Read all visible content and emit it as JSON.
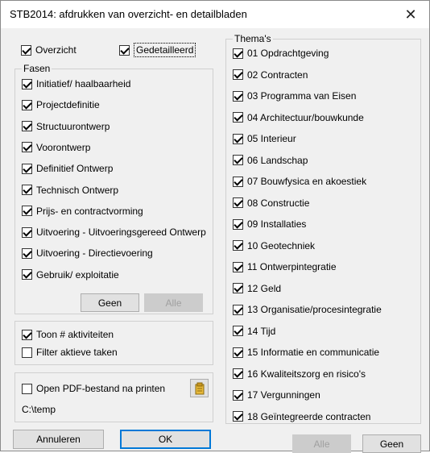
{
  "window": {
    "title": "STB2014: afdrukken van overzicht- en detailbladen",
    "close_glyph": "✕"
  },
  "view": {
    "overzicht": {
      "label": "Overzicht",
      "checked": true
    },
    "gedetailleerd": {
      "label": "Gedetailleerd",
      "checked": true
    }
  },
  "fasen": {
    "legend": "Fasen",
    "items": [
      {
        "label": "Initiatief/ haalbaarheid",
        "checked": true
      },
      {
        "label": "Projectdefinitie",
        "checked": true
      },
      {
        "label": "Structuurontwerp",
        "checked": true
      },
      {
        "label": "Voorontwerp",
        "checked": true
      },
      {
        "label": "Definitief Ontwerp",
        "checked": true
      },
      {
        "label": "Technisch Ontwerp",
        "checked": true
      },
      {
        "label": "Prijs- en contractvorming",
        "checked": true
      },
      {
        "label": "Uitvoering - Uitvoeringsgereed Ontwerp",
        "checked": true
      },
      {
        "label": "Uitvoering - Directievoering",
        "checked": true
      },
      {
        "label": "Gebruik/ exploitatie",
        "checked": true
      }
    ],
    "alle_label": "Alle",
    "geen_label": "Geen"
  },
  "options": {
    "toon": {
      "label": "Toon  # aktiviteiten",
      "checked": true
    },
    "filter": {
      "label": "Filter aktieve taken",
      "checked": false
    }
  },
  "pdf": {
    "open_label": "Open PDF-bestand na printen",
    "checked": false,
    "path": "C:\\temp",
    "folder_icon": "folder-icon"
  },
  "themas": {
    "legend": "Thema's",
    "items": [
      {
        "label": "01 Opdrachtgeving",
        "checked": true
      },
      {
        "label": "02 Contracten",
        "checked": true
      },
      {
        "label": "03 Programma van Eisen",
        "checked": true
      },
      {
        "label": "04 Architectuur/bouwkunde",
        "checked": true
      },
      {
        "label": "05 Interieur",
        "checked": true
      },
      {
        "label": "06 Landschap",
        "checked": true
      },
      {
        "label": "07 Bouwfysica en akoestiek",
        "checked": true
      },
      {
        "label": "08 Constructie",
        "checked": true
      },
      {
        "label": "09 Installaties",
        "checked": true
      },
      {
        "label": "10 Geotechniek",
        "checked": true
      },
      {
        "label": "11 Ontwerpintegratie",
        "checked": true
      },
      {
        "label": "12 Geld",
        "checked": true
      },
      {
        "label": "13 Organisatie/procesintegratie",
        "checked": true
      },
      {
        "label": "14 Tijd",
        "checked": true
      },
      {
        "label": "15 Informatie en communicatie",
        "checked": true
      },
      {
        "label": "16 Kwaliteitszorg en risico's",
        "checked": true
      },
      {
        "label": "17 Vergunningen",
        "checked": true
      },
      {
        "label": "18 Geïntegreerde contracten",
        "checked": true
      }
    ],
    "alle_label": "Alle",
    "geen_label": "Geen"
  },
  "footer": {
    "annuleren_label": "Annuleren",
    "ok_label": "OK"
  },
  "colors": {
    "accent": "#0078d7",
    "disabled_text": "#a0a0a0",
    "dialog_bg": "#f0f0f0"
  }
}
